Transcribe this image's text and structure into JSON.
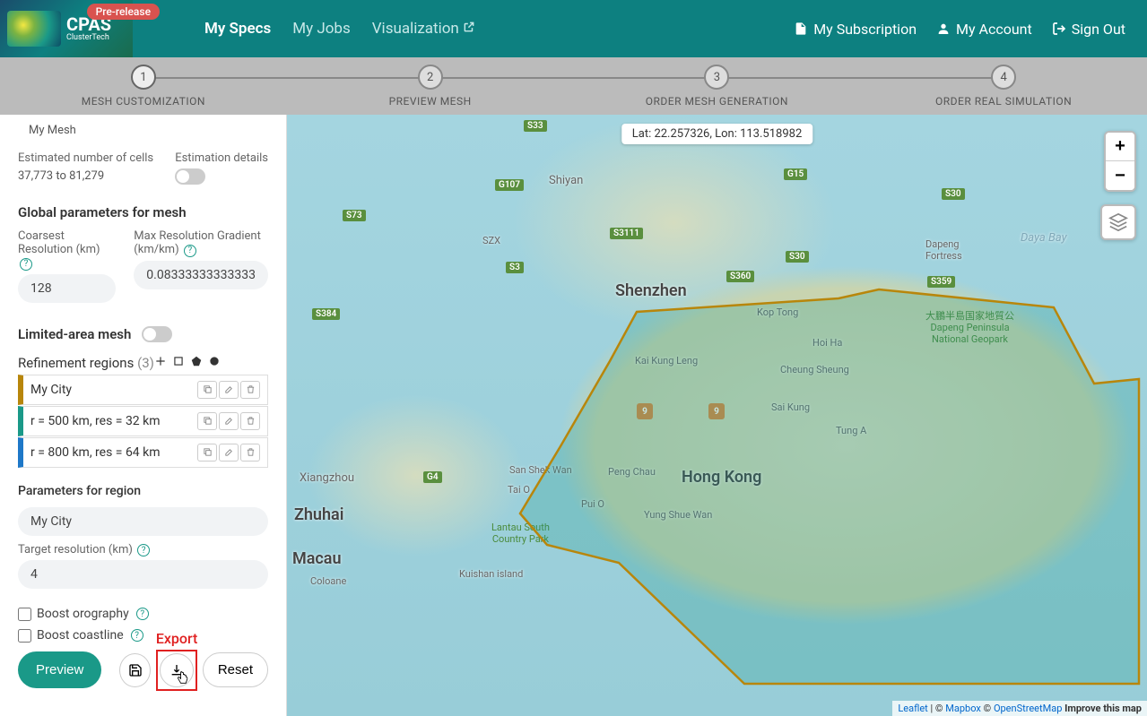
{
  "header": {
    "logo_text1": "CPAS",
    "logo_text2": "ClusterTech",
    "badge": "Pre-release",
    "nav": {
      "my_specs": "My Specs",
      "my_jobs": "My Jobs",
      "visualization": "Visualization"
    },
    "nav_right": {
      "subscription": "My Subscription",
      "account": "My Account",
      "signout": "Sign Out"
    }
  },
  "stepper": {
    "s1": {
      "num": "1",
      "label": "MESH CUSTOMIZATION"
    },
    "s2": {
      "num": "2",
      "label": "PREVIEW MESH"
    },
    "s3": {
      "num": "3",
      "label": "ORDER MESH GENERATION"
    },
    "s4": {
      "num": "4",
      "label": "ORDER REAL SIMULATION"
    }
  },
  "sidebar": {
    "mesh_name": "My Mesh",
    "est_cells_label": "Estimated number of cells",
    "est_cells_value": "37,773 to 81,279",
    "est_details_label": "Estimation details",
    "global_heading": "Global parameters for mesh",
    "coarsest_label": "Coarsest Resolution (km)",
    "coarsest_value": "128",
    "maxgrad_label": "Max Resolution Gradient (km/km)",
    "maxgrad_value": "0.08333333333333",
    "limited_heading": "Limited-area mesh",
    "refine_heading": "Refinement regions",
    "refine_count": "(3)",
    "regions": {
      "r1": "My City",
      "r2": "r = 500 km, res = 32 km",
      "r3": "r = 800 km, res = 64 km"
    },
    "params_region_heading": "Parameters for region",
    "region_name": "My City",
    "target_res_label": "Target resolution (km)",
    "target_res_value": "4",
    "boost_orog": "Boost orography",
    "boost_coast": "Boost coastline",
    "btn_preview": "Preview",
    "btn_reset": "Reset",
    "export_label": "Export"
  },
  "map": {
    "coords": "Lat: 22.257326, Lon: 113.518982",
    "cities": {
      "shenzhen": "Shenzhen",
      "hongkong": "Hong Kong",
      "zhuhai": "Zhuhai",
      "macau": "Macau",
      "shiyan": "Shiyan",
      "xiangzhou": "Xiangzhou",
      "coloane": "Coloane",
      "szx": "SZX",
      "koptong": "Kop Tong",
      "hoiha": "Hoi Ha",
      "cheungshueng": "Cheung Sheung",
      "saikung": "Sai Kung",
      "tunga": "Tung A",
      "kaikungleng": "Kai Kung Leng",
      "pengchau": "Peng Chau",
      "taio": "Tai O",
      "sanshekwan": "San Shek Wan",
      "puio": "Pui O",
      "yungshuewan": "Yung Shue Wan",
      "kuishan": "Kuishan island",
      "dayabay": "Daya Bay",
      "dapeng": "Dapeng\nFortress",
      "lantau": "Lantau South\nCountry Park",
      "geopark": "大鵬半島国家地質公\nDapeng Peninsula\nNational Geopark"
    },
    "highways": {
      "s33": "S33",
      "g107": "G107",
      "g15": "G15",
      "s73": "S73",
      "s3111": "S3111",
      "s30a": "S30",
      "s30b": "S30",
      "s3": "S3",
      "s384": "S384",
      "g4": "G4",
      "s360": "S360",
      "s359": "S359"
    },
    "routes": {
      "r9a": "9",
      "r9b": "9"
    },
    "attrib": {
      "leaflet": "Leaflet",
      "sep1": " | © ",
      "mapbox": "Mapbox",
      "sep2": " © ",
      "osm": "OpenStreetMap",
      "improve": " Improve this map"
    }
  }
}
